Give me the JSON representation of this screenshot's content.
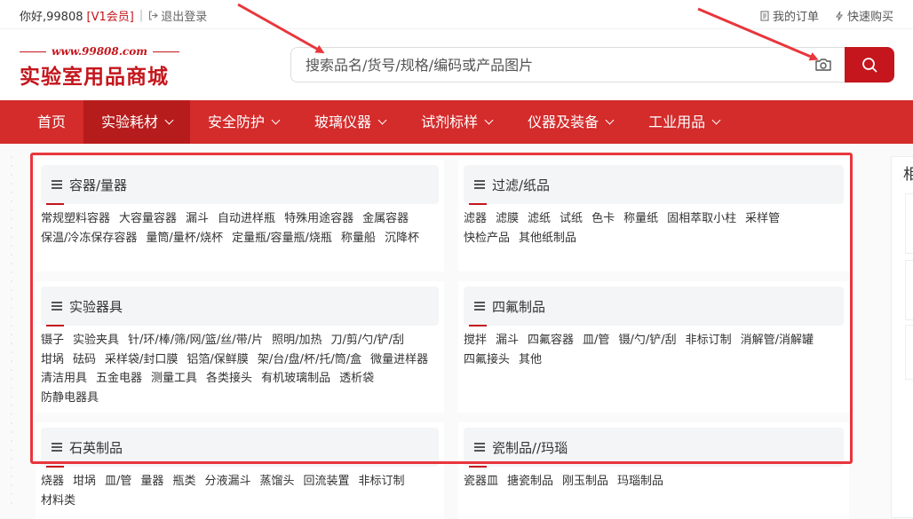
{
  "topbar": {
    "greeting": "你好,99808",
    "vip": "[V1会员]",
    "logout": "退出登录",
    "orders": "我的订单",
    "quick_buy": "快速购买"
  },
  "logo": {
    "url": "www.99808.com",
    "name": "实验室用品商城"
  },
  "search": {
    "placeholder": "搜索品名/货号/规格/编码或产品图片"
  },
  "nav": {
    "items": [
      "首页",
      "实验耗材",
      "安全防护",
      "玻璃仪器",
      "试剂标样",
      "仪器及装备",
      "工业用品"
    ]
  },
  "categories": [
    {
      "title": "容器/量器",
      "items": [
        "常规塑料容器",
        "大容量容器",
        "漏斗",
        "自动进样瓶",
        "特殊用途容器",
        "金属容器",
        "保温/冷冻保存容器",
        "量筒/量杯/烧杯",
        "定量瓶/容量瓶/烧瓶",
        "称量船",
        "沉降杯"
      ]
    },
    {
      "title": "过滤/纸品",
      "items": [
        "滤器",
        "滤膜",
        "滤纸",
        "试纸",
        "色卡",
        "称量纸",
        "固相萃取小柱",
        "采样管",
        "快检产品",
        "其他纸制品"
      ]
    },
    {
      "title": "实验器具",
      "items": [
        "镊子",
        "实验夹具",
        "针/环/棒/筛/网/篮/丝/带/片",
        "照明/加热",
        "刀/剪/勺/铲/刮",
        "坩埚",
        "砝码",
        "采样袋/封口膜",
        "铝箔/保鲜膜",
        "架/台/盘/杯/托/筒/盒",
        "微量进样器",
        "清洁用具",
        "五金电器",
        "测量工具",
        "各类接头",
        "有机玻璃制品",
        "透析袋",
        "防静电器具"
      ]
    },
    {
      "title": "四氟制品",
      "items": [
        "搅拌",
        "漏斗",
        "四氟容器",
        "皿/管",
        "镊/勺/铲/刮",
        "非标订制",
        "消解管/消解罐",
        "四氟接头",
        "其他"
      ]
    },
    {
      "title": "石英制品",
      "items": [
        "烧器",
        "坩埚",
        "皿/管",
        "量器",
        "瓶类",
        "分液漏斗",
        "蒸馏头",
        "回流装置",
        "非标订制",
        "材料类"
      ]
    },
    {
      "title": "瓷制品//玛瑙",
      "items": [
        "瓷器皿",
        "搪瓷制品",
        "刚玉制品",
        "玛瑙制品"
      ]
    }
  ],
  "side": {
    "char": "相"
  },
  "colors": {
    "brand": "#c4161c",
    "nav_bg": "#d42b2b",
    "nav_active": "#b71c1c",
    "annotation": "#e8363c"
  }
}
